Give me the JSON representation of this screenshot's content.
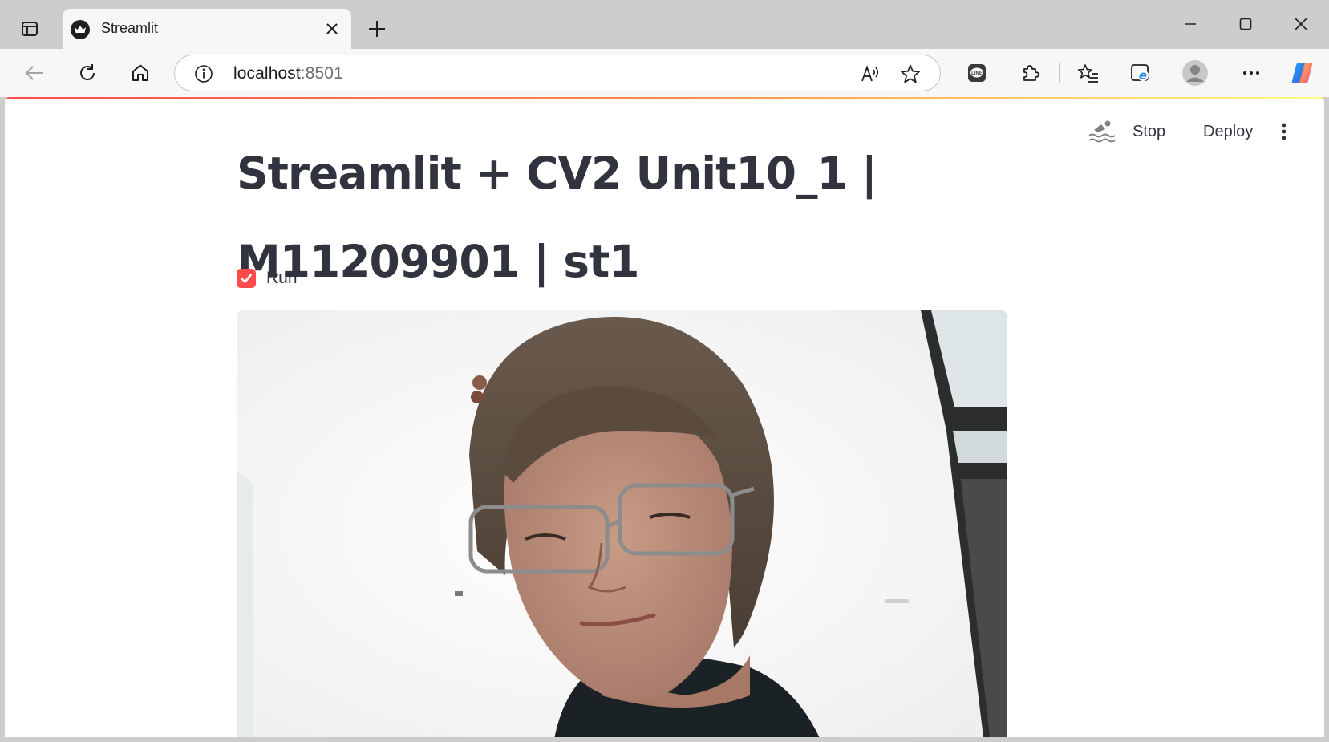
{
  "browser": {
    "tab": {
      "title": "Streamlit"
    },
    "address": {
      "host": "localhost",
      "port": ":8501"
    }
  },
  "app": {
    "header": {
      "stop_label": "Stop",
      "deploy_label": "Deploy"
    },
    "title_line1": "Streamlit + CV2 Unit10_1 |",
    "title_line2": "M11209901 | st1",
    "checkbox": {
      "label": "Run",
      "checked": true
    },
    "colors": {
      "accent": "#ff4b4b",
      "text": "#31333f"
    }
  }
}
